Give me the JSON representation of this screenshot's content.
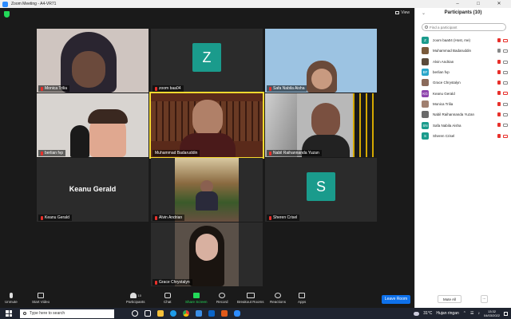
{
  "window": {
    "title": "Zoom Meeting - A4-VR71"
  },
  "header": {
    "view_label": "View"
  },
  "tiles": [
    {
      "name": "Monica Trilia",
      "muted": true,
      "type": "video"
    },
    {
      "name": "zoom baa04",
      "muted": true,
      "type": "avatar",
      "initial": "Z"
    },
    {
      "name": "Safa Nabila Aisha",
      "muted": true,
      "type": "video"
    },
    {
      "name": "berlian fvp",
      "muted": true,
      "type": "video"
    },
    {
      "name": "Muhammad Badaruddin",
      "muted": false,
      "type": "video",
      "active": true
    },
    {
      "name": "Nabil Raihannanda Yuzan",
      "muted": true,
      "type": "video"
    },
    {
      "name": "Keanu Gerald",
      "muted": true,
      "type": "name",
      "display_name": "Keanu Gerald"
    },
    {
      "name": "Alvin Andrian",
      "muted": true,
      "type": "video"
    },
    {
      "name": "Sheren Crisel",
      "muted": true,
      "type": "avatar",
      "initial": "S"
    },
    {
      "name": "Grace Chrystalyn",
      "muted": true,
      "type": "video"
    }
  ],
  "toolbar": {
    "unmute": "Unmute",
    "start_video": "Start Video",
    "participants": "Participants",
    "participants_count": "10",
    "chat": "Chat",
    "share_screen": "Share Screen",
    "record": "Record",
    "breakout_rooms": "Breakout Rooms",
    "reactions": "Reactions",
    "apps": "Apps",
    "leave": "Leave Room"
  },
  "panel": {
    "title": "Participants (10)",
    "search_placeholder": "Find a participant",
    "participants": [
      {
        "name": "zoom baa04 (Host, me)",
        "initials": "Z",
        "color": "#1a9b8c",
        "mic_muted": true,
        "cam_off": true
      },
      {
        "name": "Muhammad Badaruddin",
        "initials": "",
        "color": "#7a5a3a",
        "mic_muted": false,
        "cam_off": false
      },
      {
        "name": "Alvin Andrian",
        "initials": "",
        "color": "#5a4a3a",
        "mic_muted": true,
        "cam_off": false
      },
      {
        "name": "berlian fvp",
        "initials": "BF",
        "color": "#2aa6c9",
        "mic_muted": true,
        "cam_off": false
      },
      {
        "name": "Grace Chrystalyn",
        "initials": "",
        "color": "#8a6a5a",
        "mic_muted": true,
        "cam_off": false
      },
      {
        "name": "Keanu Gerald",
        "initials": "KG",
        "color": "#8e44ad",
        "mic_muted": true,
        "cam_off": true
      },
      {
        "name": "Monica Trilia",
        "initials": "",
        "color": "#a08070",
        "mic_muted": true,
        "cam_off": false
      },
      {
        "name": "Nabil Raihannanda Yuzan",
        "initials": "",
        "color": "#6a6a6a",
        "mic_muted": true,
        "cam_off": false
      },
      {
        "name": "Safa Nabila Aisha",
        "initials": "SN",
        "color": "#1a9b8c",
        "mic_muted": true,
        "cam_off": false
      },
      {
        "name": "Sheren Crisel",
        "initials": "S",
        "color": "#1a9b8c",
        "mic_muted": true,
        "cam_off": true
      }
    ],
    "mute_all": "Mute All",
    "more": "..."
  },
  "taskbar": {
    "search_placeholder": "Type here to search",
    "weather": "31°C",
    "weather_text": "Hujan ringan",
    "time": "13:32",
    "date": "04/03/2022"
  },
  "colors": {
    "accent": "#0e71eb",
    "mute_red": "#e8302b",
    "active_speaker": "#f5d92e",
    "avatar_teal": "#1a9b8c"
  }
}
